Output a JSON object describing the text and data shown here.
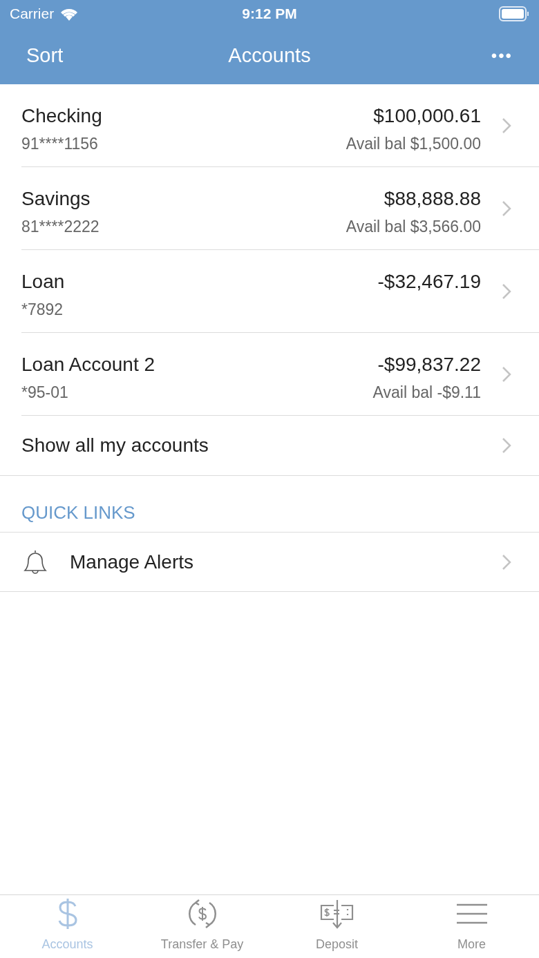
{
  "status_bar": {
    "carrier": "Carrier",
    "time": "9:12 PM"
  },
  "nav": {
    "left": "Sort",
    "title": "Accounts",
    "more": "•••"
  },
  "accounts": [
    {
      "name": "Checking",
      "number": "91****1156",
      "balance": "$100,000.61",
      "available": "Avail bal $1,500.00"
    },
    {
      "name": "Savings",
      "number": "81****2222",
      "balance": "$88,888.88",
      "available": "Avail bal $3,566.00"
    },
    {
      "name": "Loan",
      "number": "*7892",
      "balance": "-$32,467.19"
    },
    {
      "name": "Loan Account 2",
      "number": "*95-01",
      "balance": "-$99,837.22",
      "available": "Avail bal -$9.11"
    }
  ],
  "show_all": "Show all my accounts",
  "quick_links": {
    "header": "QUICK LINKS",
    "items": [
      {
        "label": "Manage Alerts",
        "kind": "bell"
      }
    ]
  },
  "tabs": [
    {
      "label": "Accounts",
      "kind": "dollar",
      "selected": true
    },
    {
      "label": "Transfer & Pay",
      "kind": "transfer",
      "selected": false
    },
    {
      "label": "Deposit",
      "kind": "deposit",
      "selected": false
    },
    {
      "label": "More",
      "kind": "menu",
      "selected": false
    }
  ]
}
